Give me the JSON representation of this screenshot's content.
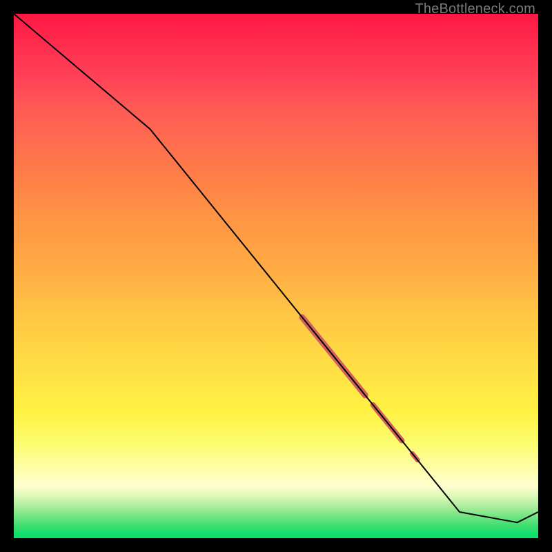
{
  "watermark": "TheBottleneck.com",
  "chart_data": {
    "type": "line",
    "title": "",
    "xlabel": "",
    "ylabel": "",
    "xlim": [
      0,
      100
    ],
    "ylim": [
      0,
      100
    ],
    "grid": false,
    "series": [
      {
        "name": "bottleneck-curve",
        "x": [
          0,
          26,
          85,
          96,
          100
        ],
        "y": [
          100,
          78,
          5,
          3,
          5
        ],
        "color": "#000000",
        "width": 2.0
      }
    ],
    "highlight_segments": [
      {
        "name": "segment-1",
        "x_start": 55,
        "x_end": 67,
        "color": "#d2615f",
        "width": 9
      },
      {
        "name": "segment-2",
        "x_start": 68.5,
        "x_end": 74,
        "color": "#d2615f",
        "width": 8
      },
      {
        "name": "segment-3",
        "x_start": 76,
        "x_end": 77,
        "color": "#d2615f",
        "width": 7
      }
    ]
  }
}
